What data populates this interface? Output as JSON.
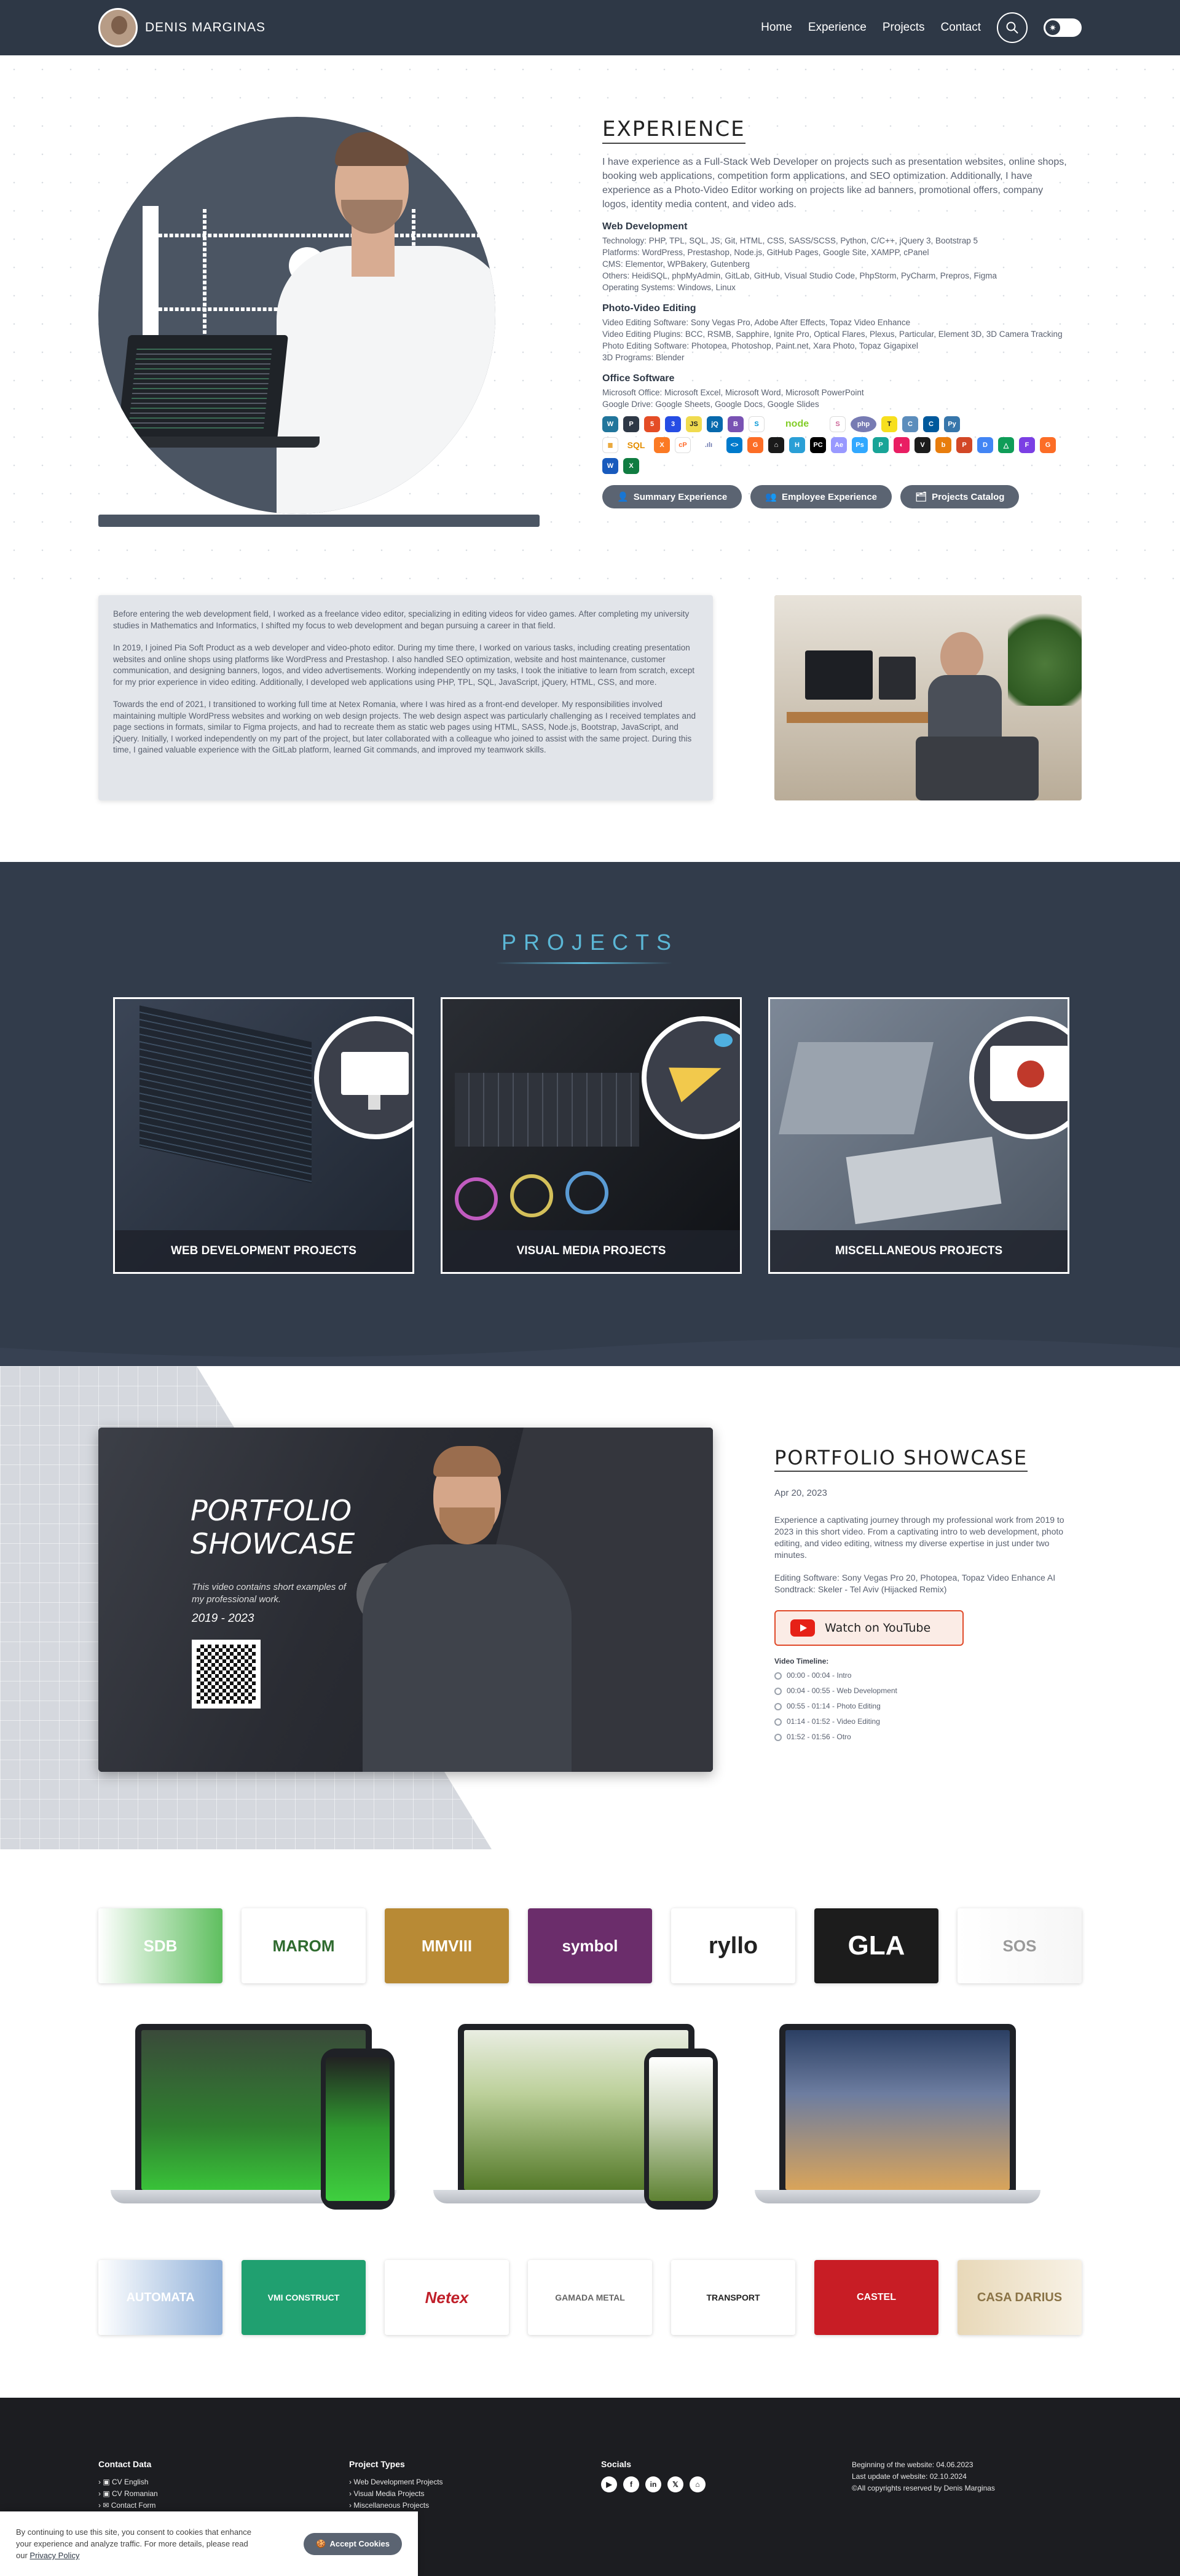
{
  "header": {
    "brand": "DENIS MARGINAS",
    "nav": [
      "Home",
      "Experience",
      "Projects",
      "Contact"
    ]
  },
  "experience": {
    "title": "EXPERIENCE",
    "intro": "I have experience as a Full-Stack Web Developer on projects such as presentation websites, online shops, booking web applications, competition form applications, and SEO optimization. Additionally, I have experience as a Photo-Video Editor working on projects like ad banners, promotional offers, company logos, identity media content, and video ads.",
    "web_title": "Web Development",
    "web_lines": [
      "Technology: PHP, TPL, SQL, JS, Git, HTML, CSS, SASS/SCSS, Python, C/C++, jQuery 3, Bootstrap 5",
      "Platforms: WordPress, Prestashop, Node.js, GitHub Pages, Google Site, XAMPP, cPanel",
      "CMS: Elementor, WPBakery, Gutenberg",
      "Others: HeidiSQL, phpMyAdmin, GitLab, GitHub, Visual Studio Code, PhpStorm, PyCharm, Prepros, Figma",
      "Operating Systems: Windows, Linux"
    ],
    "photo_title": "Photo-Video Editing",
    "photo_lines": [
      "Video Editing Software: Sony Vegas Pro, Adobe After Effects, Topaz Video Enhance",
      "Video Editing Plugins: BCC, RSMB, Sapphire, Ignite Pro, Optical Flares, Plexus, Particular, Element 3D, 3D Camera Tracking",
      "Photo Editing Software: Photopea, Photoshop, Paint.net, Xara Photo, Topaz Gigapixel",
      "3D Programs: Blender"
    ],
    "office_title": "Office Software",
    "office_lines": [
      "Microsoft Office: Microsoft Excel, Microsoft Word, Microsoft PowerPoint",
      "Google Drive: Google Sheets, Google Docs, Google Slides"
    ],
    "buttons": [
      "Summary Experience",
      "Employee Experience",
      "Projects Catalog"
    ]
  },
  "bio": {
    "p1": "Before entering the web development field, I worked as a freelance video editor, specializing in editing videos for video games. After completing my university studies in Mathematics and Informatics, I shifted my focus to web development and began pursuing a career in that field.",
    "p2": "In 2019, I joined Pia Soft Product as a web developer and video-photo editor. During my time there, I worked on various tasks, including creating presentation websites and online shops using platforms like WordPress and Prestashop. I also handled SEO optimization, website and host maintenance, customer communication, and designing banners, logos, and video advertisements. Working independently on my tasks, I took the initiative to learn from scratch, except for my prior experience in video editing. Additionally, I developed web applications using PHP, TPL, SQL, JavaScript, jQuery, HTML, CSS, and more.",
    "p3": "Towards the end of 2021, I transitioned to working full time at Netex Romania, where I was hired as a front-end developer. My responsibilities involved maintaining multiple WordPress websites and working on web design projects. The web design aspect was particularly challenging as I received templates and page sections in formats, similar to Figma projects, and had to recreate them as static web pages using HTML, SASS, Node.js, Bootstrap, JavaScript, and jQuery. Initially, I worked independently on my part of the project, but later collaborated with a colleague who joined to assist with the same project. During this time, I gained valuable experience with the GitLab platform, learned Git commands, and improved my teamwork skills."
  },
  "projects": {
    "title": "PROJECTS",
    "cards": [
      "WEB DEVELOPMENT PROJECTS",
      "VISUAL MEDIA PROJECTS",
      "MISCELLANEOUS PROJECTS"
    ]
  },
  "portfolio": {
    "video_title_1": "PORTFOLIO",
    "video_title_2": "SHOWCASE",
    "video_sub": "This video contains short examples of my professional work.",
    "video_years": "2019 - 2023",
    "title": "PORTFOLIO SHOWCASE",
    "date": "Apr 20, 2023",
    "desc": "Experience a captivating journey through my professional work from 2019 to 2023 in this short video. From a captivating intro to web development, photo editing, and video editing, witness my diverse expertise in just under two minutes.",
    "software": "Editing Software: Sony Vegas Pro 20, Photopea, Topaz Video Enhance AI",
    "soundtrack": "Sondtrack: Skeler - Tel Aviv (Hijacked Remix)",
    "yt_label": "Watch on YouTube",
    "timeline_title": "Video Timeline:",
    "timeline": [
      "00:00 - 00:04 - Intro",
      "00:04 - 00:55 - Web Development",
      "00:55 - 01:14 - Photo Editing",
      "01:14 - 01:52 - Video Editing",
      "01:52 - 01:56 - Otro"
    ]
  },
  "clients_row1": [
    "SDB",
    "MAROM",
    "MMVIII",
    "symbol",
    "ryllo",
    "GLA",
    "SOS"
  ],
  "clients_row2": [
    "AUTOMATA",
    "VMI CONSTRUCT",
    "Netex",
    "GAMADA METAL",
    "TRANSPORT",
    "CASTEL",
    "CASA DARIUS"
  ],
  "footer": {
    "contact_title": "Contact Data",
    "contact": [
      "CV English",
      "CV Romanian",
      "Contact Form"
    ],
    "types_title": "Project Types",
    "types": [
      "Web Development Projects",
      "Visual Media Projects",
      "Miscellaneous Projects"
    ],
    "socials_title": "Socials",
    "info": [
      "Beginning of the website: 04.06.2023",
      "Last update of website: 02.10.2024",
      "©All copyrights reserved by Denis Marginas"
    ]
  },
  "cookie": {
    "text": "By continuing to use this site, you consent to cookies that enhance your experience and analyze traffic. For more details, please read our",
    "link": "Privacy Policy",
    "button": "Accept Cookies"
  }
}
